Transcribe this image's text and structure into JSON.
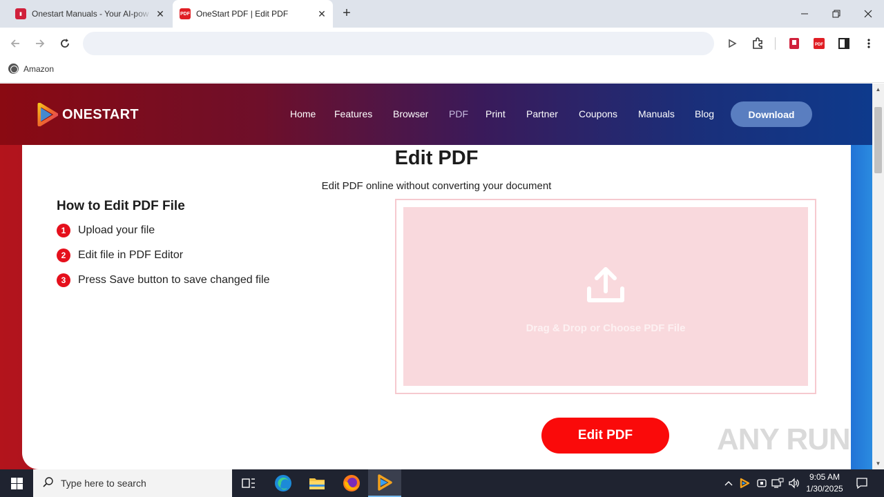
{
  "browser": {
    "tabs": [
      {
        "title": "Onestart Manuals - Your AI-pow",
        "close": "✕"
      },
      {
        "title": "OneStart PDF | Edit PDF",
        "close": "✕"
      }
    ],
    "new_tab": "+",
    "address": "",
    "bookmarks": [
      {
        "label": "Amazon"
      }
    ]
  },
  "site": {
    "brand": "ONESTART",
    "nav": [
      "Home",
      "Features",
      "Browser",
      "PDF",
      "Print",
      "Partner",
      "Coupons",
      "Manuals",
      "Blog"
    ],
    "download_label": "Download",
    "title": "Edit PDF",
    "subtitle": "Edit PDF online without converting your document",
    "howto_title": "How to Edit PDF File",
    "steps": [
      {
        "num": "1",
        "text": "Upload your file"
      },
      {
        "num": "2",
        "text": "Edit file in PDF Editor"
      },
      {
        "num": "3",
        "text": "Press Save button to save changed file"
      }
    ],
    "dropzone_text": "Drag & Drop or Choose PDF File",
    "edit_button": "Edit PDF",
    "watermark": "ANY RUN"
  },
  "taskbar": {
    "search_placeholder": "Type here to search",
    "time": "9:05 AM",
    "date": "1/30/2025"
  },
  "colors": {
    "accent_red": "#fa0a0a",
    "step_badge": "#e5101c",
    "download_btn": "#5a7ec0",
    "dropzone": "#f9d9dd"
  }
}
